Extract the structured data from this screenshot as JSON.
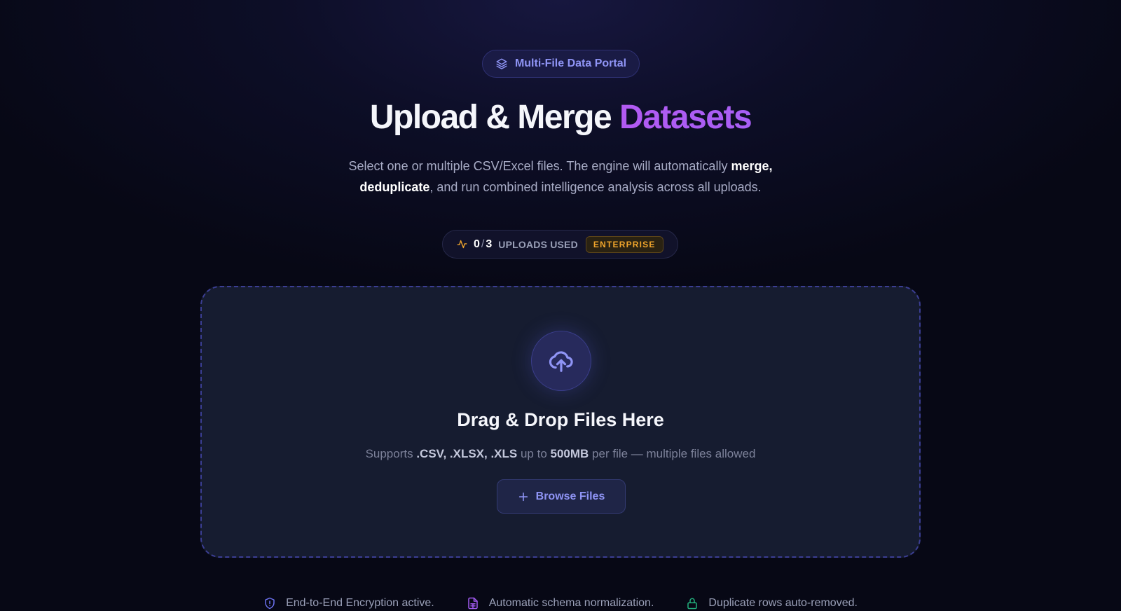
{
  "header": {
    "portal_label": "Multi-File Data Portal",
    "title_main": "Upload & Merge",
    "title_accent": "Datasets",
    "subtitle_part1": "Select one or multiple CSV/Excel files. The engine will automatically ",
    "subtitle_bold1": "merge, deduplicate",
    "subtitle_part2": ", and run combined intelligence analysis across all uploads."
  },
  "usage": {
    "used": "0",
    "separator": "/",
    "limit": "3",
    "label": "UPLOADS USED",
    "plan_badge": "ENTERPRISE"
  },
  "dropzone": {
    "title": "Drag & Drop Files Here",
    "sub_prefix": "Supports ",
    "sub_formats": ".CSV, .XLSX, .XLS",
    "sub_mid": " up to ",
    "sub_size": "500MB",
    "sub_suffix": " per file — multiple files allowed",
    "browse_label": "Browse Files"
  },
  "features": [
    {
      "icon": "shield-alert-icon",
      "label": "End-to-End Encryption active."
    },
    {
      "icon": "file-spreadsheet-icon",
      "label": "Automatic schema normalization."
    },
    {
      "icon": "lock-icon",
      "label": "Duplicate rows auto-removed."
    }
  ],
  "colors": {
    "accent_indigo": "#8f94f5",
    "accent_purple": "#b25af2",
    "badge_amber": "#f0a52c",
    "feature_green": "#22b07d"
  }
}
